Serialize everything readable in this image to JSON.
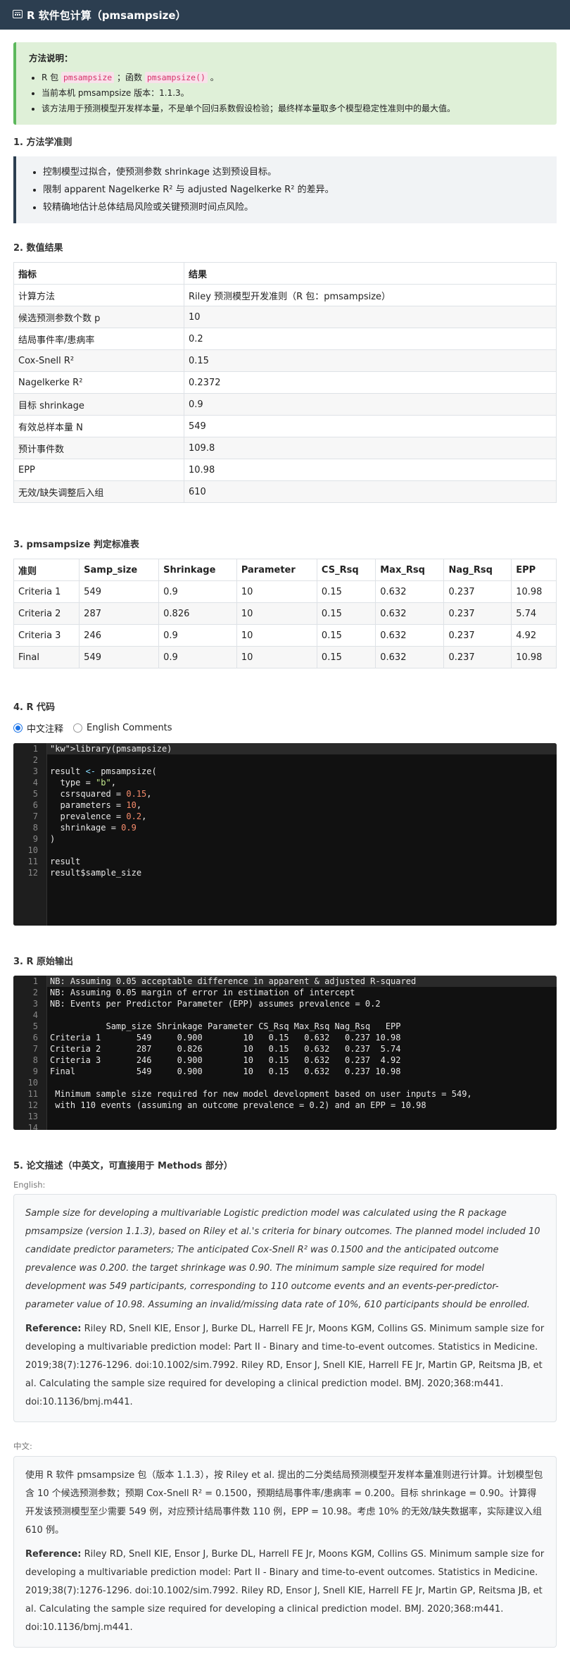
{
  "header": {
    "icon": "calculator-icon",
    "title": "R 软件包计算（pmsampsize）"
  },
  "notice": {
    "title": "方法说明：",
    "items": [
      {
        "pre": "R 包 ",
        "pkg": "pmsampsize",
        "mid": " ；函数 ",
        "fn": "pmsampsize()",
        "post": " 。"
      },
      {
        "text": "当前本机 pmsampsize 版本：1.1.3。"
      },
      {
        "text": "该方法用于预测模型开发样本量，不是单个回归系数假设检验；最终样本量取多个模型稳定性准则中的最大值。"
      }
    ]
  },
  "sec1": {
    "title": "1. 方法学准则",
    "items": [
      "控制模型过拟合，使预测参数 shrinkage 达到预设目标。",
      "限制 apparent Nagelkerke R² 与 adjusted Nagelkerke R² 的差异。",
      "较精确地估计总体结局风险或关键预测时间点风险。"
    ]
  },
  "sec2": {
    "title": "2. 数值结果",
    "headers": [
      "指标",
      "结果"
    ],
    "rows": [
      [
        "计算方法",
        "Riley 预测模型开发准则（R 包：pmsampsize）"
      ],
      [
        "候选预测参数个数 p",
        "10"
      ],
      [
        "结局事件率/患病率",
        "0.2"
      ],
      [
        "Cox-Snell R²",
        "0.15"
      ],
      [
        "Nagelkerke R²",
        "0.2372"
      ],
      [
        "目标 shrinkage",
        "0.9"
      ],
      [
        "有效总样本量 N",
        "549"
      ],
      [
        "预计事件数",
        "109.8"
      ],
      [
        "EPP",
        "10.98"
      ],
      [
        "无效/缺失调整后入组",
        "610"
      ]
    ]
  },
  "sec3": {
    "title": "3. pmsampsize 判定标准表",
    "headers": [
      "准则",
      "Samp_size",
      "Shrinkage",
      "Parameter",
      "CS_Rsq",
      "Max_Rsq",
      "Nag_Rsq",
      "EPP"
    ],
    "rows": [
      [
        "Criteria 1",
        "549",
        "0.9",
        "10",
        "0.15",
        "0.632",
        "0.237",
        "10.98"
      ],
      [
        "Criteria 2",
        "287",
        "0.826",
        "10",
        "0.15",
        "0.632",
        "0.237",
        "5.74"
      ],
      [
        "Criteria 3",
        "246",
        "0.9",
        "10",
        "0.15",
        "0.632",
        "0.237",
        "4.92"
      ],
      [
        "Final",
        "549",
        "0.9",
        "10",
        "0.15",
        "0.632",
        "0.237",
        "10.98"
      ]
    ]
  },
  "sec4": {
    "title": "4. R 代码",
    "radio_cn": "中文注释",
    "radio_en": "English Comments",
    "selected": "中文注释",
    "code_lines": [
      "library(pmsampsize)",
      "",
      "result <- pmsampsize(",
      "  type = \"b\",",
      "  csrsquared = 0.15,",
      "  parameters = 10,",
      "  prevalence = 0.2,",
      "  shrinkage = 0.9",
      ")",
      "",
      "result",
      "result$sample_size"
    ]
  },
  "sec_out": {
    "title": "3. R 原始输出",
    "lines": [
      "NB: Assuming 0.05 acceptable difference in apparent & adjusted R-squared",
      "NB: Assuming 0.05 margin of error in estimation of intercept",
      "NB: Events per Predictor Parameter (EPP) assumes prevalence = 0.2",
      "",
      "           Samp_size Shrinkage Parameter CS_Rsq Max_Rsq Nag_Rsq   EPP",
      "Criteria 1       549     0.900        10   0.15   0.632   0.237 10.98",
      "Criteria 2       287     0.826        10   0.15   0.632   0.237  5.74",
      "Criteria 3       246     0.900        10   0.15   0.632   0.237  4.92",
      "Final            549     0.900        10   0.15   0.632   0.237 10.98",
      "",
      " Minimum sample size required for new model development based on user inputs = 549,",
      " with 110 events (assuming an outcome prevalence = 0.2) and an EPP = 10.98",
      "",
      ""
    ]
  },
  "sec5": {
    "title": "5. 论文描述（中英文，可直接用于 Methods 部分）",
    "en_label": "English:",
    "en_text": "Sample size for developing a multivariable Logistic prediction model was calculated using the R package pmsampsize (version 1.1.3), based on Riley et al.'s criteria for binary outcomes. The planned model included 10 candidate predictor parameters; The anticipated Cox-Snell R² was 0.1500 and the anticipated outcome prevalence was 0.200. the target shrinkage was 0.90. The minimum sample size required for model development was 549 participants, corresponding to 110 outcome events and an events-per-predictor-parameter value of 10.98. Assuming an invalid/missing data rate of 10%, 610 participants should be enrolled.",
    "ref_label": "Reference:",
    "ref_text": " Riley RD, Snell KIE, Ensor J, Burke DL, Harrell FE Jr, Moons KGM, Collins GS. Minimum sample size for developing a multivariable prediction model: Part II - Binary and time-to-event outcomes. Statistics in Medicine. 2019;38(7):1276-1296. doi:10.1002/sim.7992. Riley RD, Ensor J, Snell KIE, Harrell FE Jr, Martin GP, Reitsma JB, et al. Calculating the sample size required for developing a clinical prediction model. BMJ. 2020;368:m441. doi:10.1136/bmj.m441.",
    "cn_label": "中文:",
    "cn_text": "使用 R 软件 pmsampsize 包（版本 1.1.3），按 Riley et al. 提出的二分类结局预测模型开发样本量准则进行计算。计划模型包含 10 个候选预测参数；预期 Cox-Snell R² = 0.1500，预期结局事件率/患病率 = 0.200。目标 shrinkage = 0.90。计算得开发该预测模型至少需要 549 例，对应预计结局事件数 110 例，EPP = 10.98。考虑 10% 的无效/缺失数据率，实际建议入组 610 例。"
  }
}
